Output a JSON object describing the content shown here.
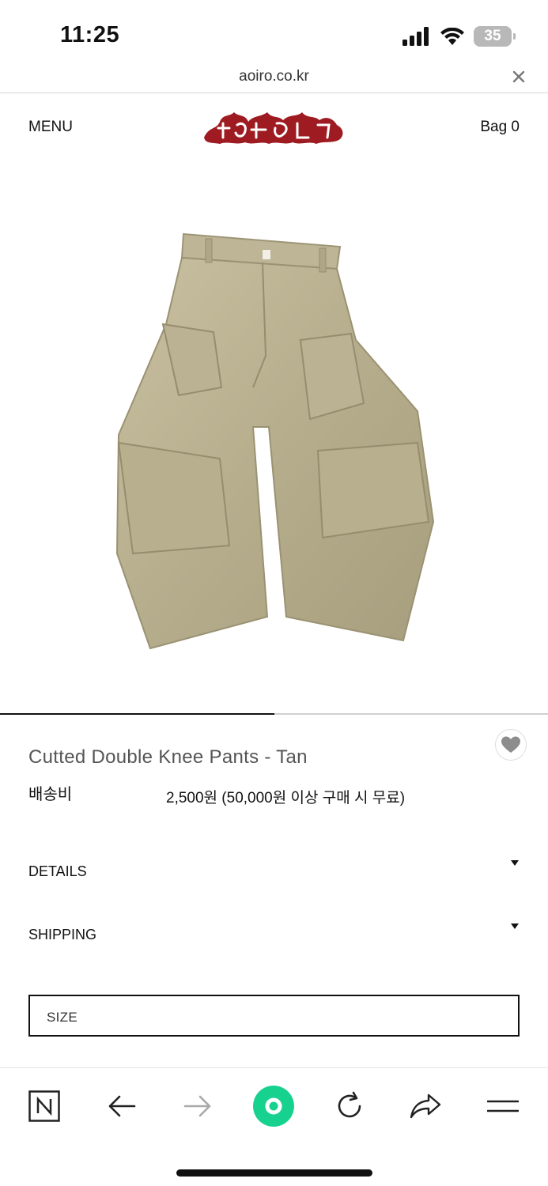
{
  "status_bar": {
    "time": "11:25",
    "battery": "35"
  },
  "url_bar": {
    "url": "aoiro.co.kr"
  },
  "header": {
    "menu_label": "MENU",
    "bag_label": "Bag 0",
    "logo_alt": "aoiro logo",
    "logo_color": "#9e1b22"
  },
  "gallery": {
    "progress": 0.5
  },
  "product": {
    "title": "Cutted Double Knee Pants - Tan",
    "shipping_label": "배송비",
    "shipping_value": "2,500원 (50,000원 이상 구매 시 무료)",
    "accent_color": "#b9b08f"
  },
  "accordions": [
    {
      "label": "DETAILS"
    },
    {
      "label": "SHIPPING"
    }
  ],
  "size_select": {
    "label": "SIZE"
  },
  "toolbar": {
    "items": [
      "naver-icon",
      "back-arrow-icon",
      "forward-arrow-icon",
      "green-dot-icon",
      "reload-icon",
      "share-icon",
      "menu-icon"
    ],
    "green": "#17d28f"
  }
}
